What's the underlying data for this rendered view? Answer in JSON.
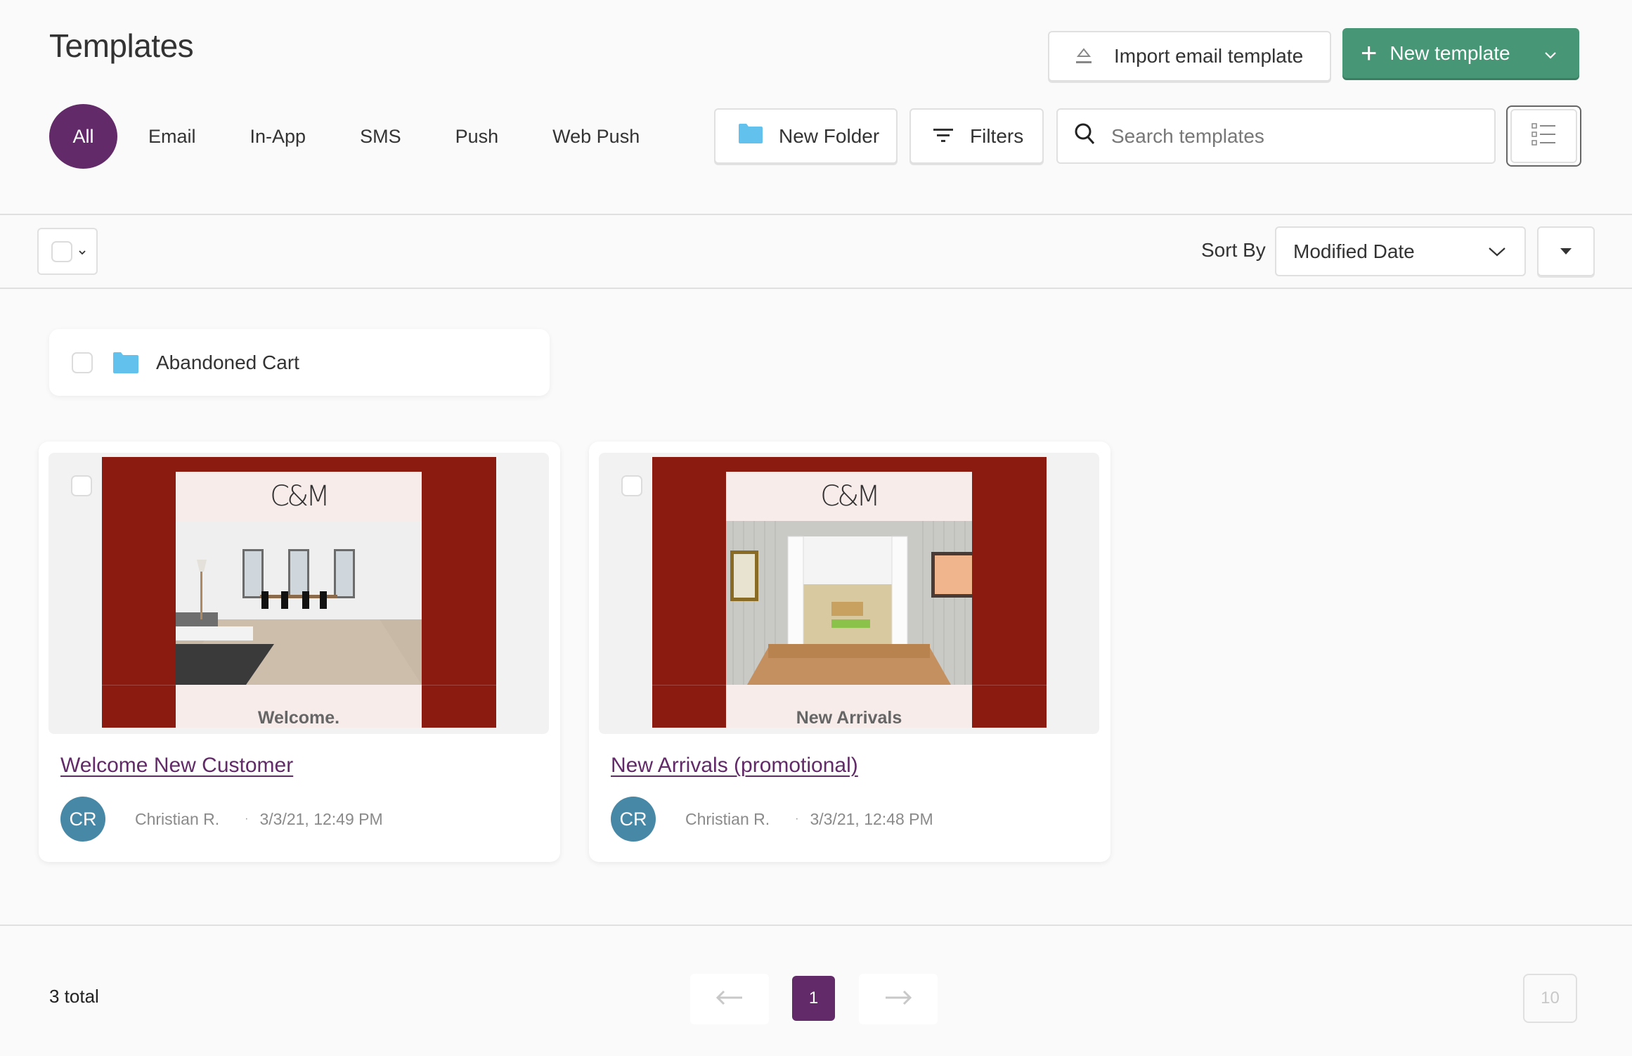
{
  "header": {
    "title": "Templates",
    "import_label": "Import email template",
    "new_template_label": "New template"
  },
  "tabs": [
    {
      "label": "All",
      "active": true
    },
    {
      "label": "Email",
      "active": false
    },
    {
      "label": "In-App",
      "active": false
    },
    {
      "label": "SMS",
      "active": false
    },
    {
      "label": "Push",
      "active": false
    },
    {
      "label": "Web Push",
      "active": false
    }
  ],
  "toolbar": {
    "new_folder_label": "New Folder",
    "filters_label": "Filters",
    "search_placeholder": "Search templates",
    "search_value": ""
  },
  "sort": {
    "label": "Sort By",
    "selected": "Modified Date"
  },
  "folders": [
    {
      "name": "Abandoned Cart"
    }
  ],
  "templates": [
    {
      "name": "Welcome New Customer",
      "preview_logo": "C&M",
      "preview_headline": "Welcome.",
      "author_initials": "CR",
      "author": "Christian R.",
      "separator": "·",
      "modified": "3/3/21, 12:49 PM"
    },
    {
      "name": "New Arrivals (promotional)",
      "preview_logo": "C&M",
      "preview_headline": "New Arrivals",
      "author_initials": "CR",
      "author": "Christian R.",
      "separator": "·",
      "modified": "3/3/21, 12:48 PM"
    }
  ],
  "footer": {
    "total": "3 total",
    "current_page": "1",
    "page_size": "10"
  },
  "colors": {
    "accent_purple": "#622a68",
    "primary_green": "#479676",
    "avatar_blue": "#4688a6",
    "folder_blue": "#63c1ee",
    "email_brand_red": "#8b1a10"
  }
}
